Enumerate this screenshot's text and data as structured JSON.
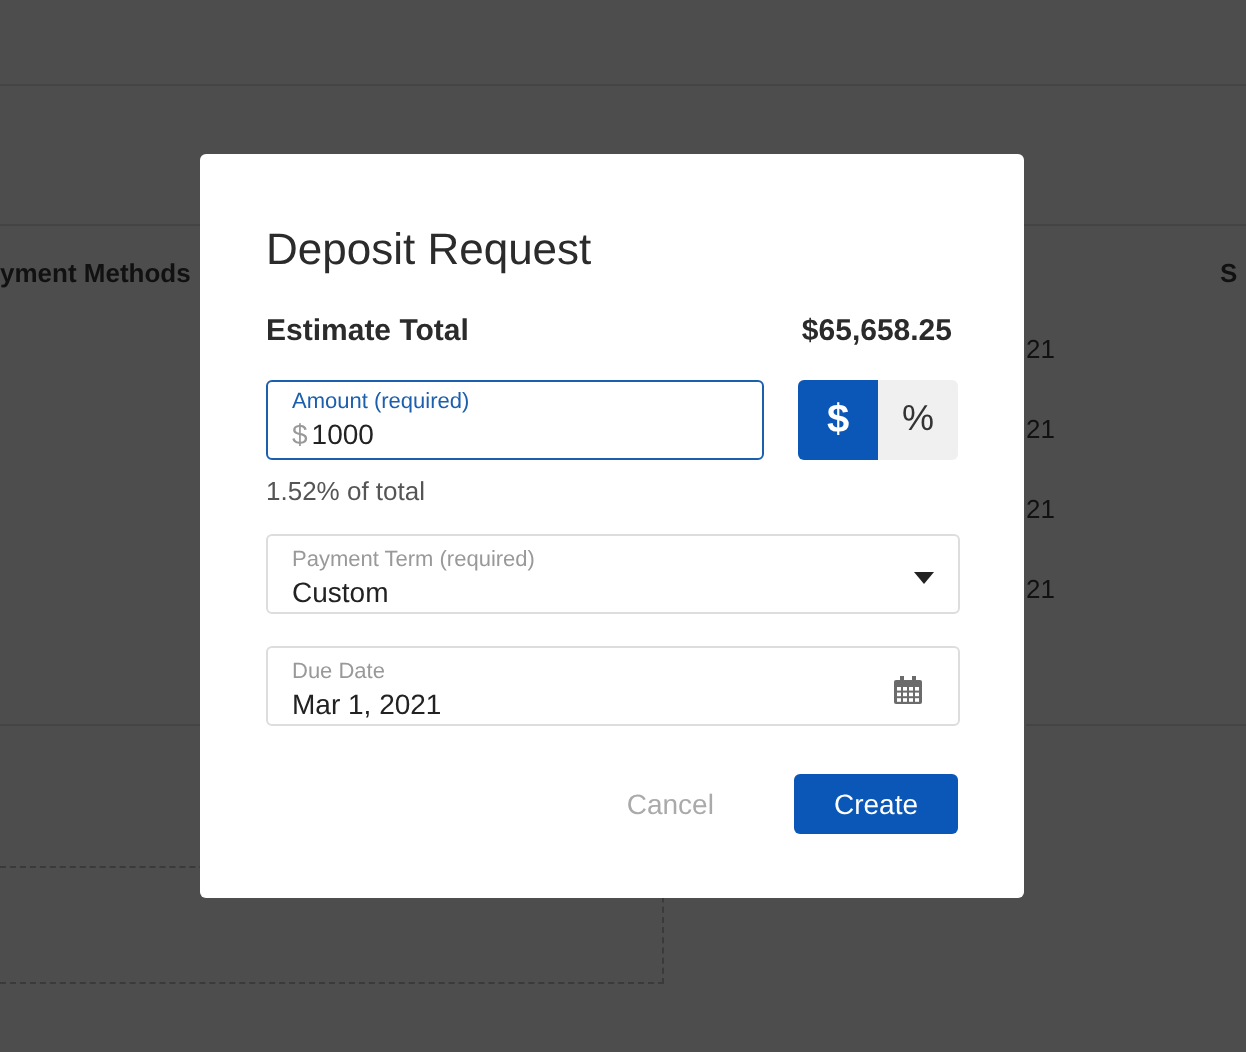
{
  "background": {
    "headers": [
      "yment Methods",
      "S"
    ],
    "rows": [
      {
        "column_2": "21"
      },
      {
        "column_2": "21"
      },
      {
        "column_2": "21"
      },
      {
        "column_2": "21"
      }
    ]
  },
  "dialog": {
    "title": "Deposit Request",
    "summary": {
      "label": "Estimate Total",
      "value": "$65,658.25"
    },
    "amount": {
      "label": "Amount (required)",
      "prefix": "$",
      "value": "1000",
      "helper": "1.52% of total"
    },
    "unit_toggle": [
      {
        "label": "$",
        "selected": true
      },
      {
        "label": "%",
        "selected": false
      }
    ],
    "payment_term": {
      "label": "Payment Term (required)",
      "value": "Custom"
    },
    "due_date": {
      "label": "Due Date",
      "value": "Mar 1, 2021"
    },
    "buttons": [
      {
        "label": "Cancel",
        "kind": "secondary"
      },
      {
        "label": "Create",
        "kind": "primary"
      }
    ]
  }
}
